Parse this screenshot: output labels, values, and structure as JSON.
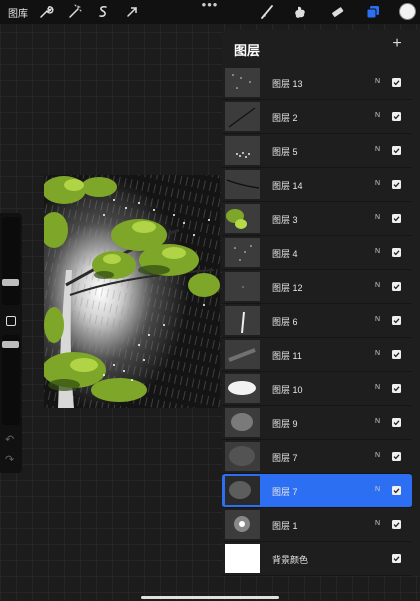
{
  "toolbar": {
    "gallery_label": "图库",
    "icons": [
      "wrench-icon",
      "magic-wand-icon",
      "selection-icon",
      "transform-arrow-icon",
      "more-dots-icon",
      "brush-icon",
      "smudge-icon",
      "eraser-icon",
      "layers-icon",
      "color-swatch"
    ],
    "active_color": "#f2f2f2",
    "accent": "#2d6ff2"
  },
  "layers_panel": {
    "title": "图层",
    "add_label": "+",
    "layers": [
      {
        "name": "图层 13",
        "blend": "N",
        "visible": true,
        "active": false,
        "thumb": "sprinkles"
      },
      {
        "name": "图层 2",
        "blend": "N",
        "visible": true,
        "active": false,
        "thumb": "branch"
      },
      {
        "name": "图层 5",
        "blend": "N",
        "visible": true,
        "active": false,
        "thumb": "specks"
      },
      {
        "name": "图层 14",
        "blend": "N",
        "visible": true,
        "active": false,
        "thumb": "twig"
      },
      {
        "name": "图层 3",
        "blend": "N",
        "visible": true,
        "active": false,
        "thumb": "leaves"
      },
      {
        "name": "图层 4",
        "blend": "N",
        "visible": true,
        "active": false,
        "thumb": "dots"
      },
      {
        "name": "图层 12",
        "blend": "N",
        "visible": true,
        "active": false,
        "thumb": "faint"
      },
      {
        "name": "图层 6",
        "blend": "N",
        "visible": true,
        "active": false,
        "thumb": "trunk"
      },
      {
        "name": "图层 11",
        "blend": "N",
        "visible": true,
        "active": false,
        "thumb": "streaks"
      },
      {
        "name": "图层 10",
        "blend": "N",
        "visible": true,
        "active": false,
        "thumb": "cloud"
      },
      {
        "name": "图层 9",
        "blend": "N",
        "visible": true,
        "active": false,
        "thumb": "blur"
      },
      {
        "name": "图层 7",
        "blend": "N",
        "visible": true,
        "active": false,
        "thumb": "haze"
      },
      {
        "name": "图层 7",
        "blend": "N",
        "visible": true,
        "active": true,
        "thumb": "rain"
      },
      {
        "name": "图层 1",
        "blend": "N",
        "visible": true,
        "active": false,
        "thumb": "glow"
      },
      {
        "name": "背景颜色",
        "blend": "",
        "visible": true,
        "active": false,
        "thumb": "white"
      }
    ]
  }
}
